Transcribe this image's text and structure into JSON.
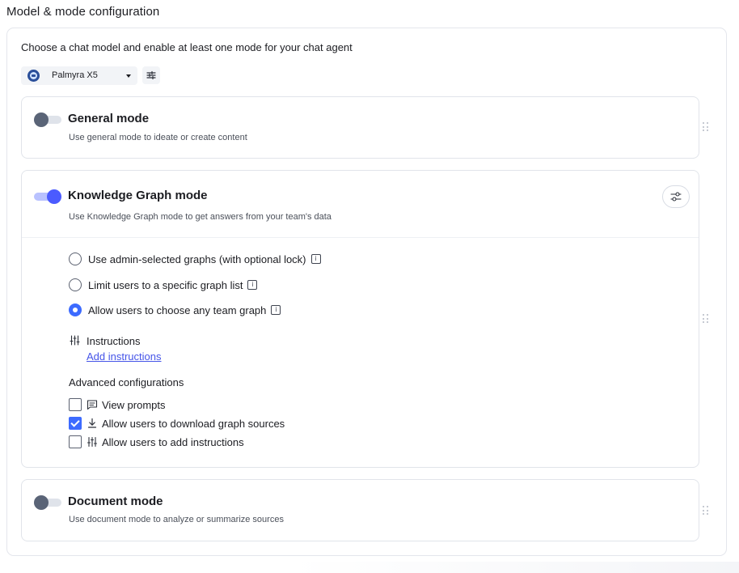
{
  "section": {
    "title": "Model & mode configuration",
    "subtitle": "Choose a chat model and enable at least one mode for your chat agent"
  },
  "model_selector": {
    "selected_model": "Palmyra X5",
    "avatar_icon": "palmyra-logo-icon",
    "caret_icon": "caret-down-icon",
    "settings_icon": "sliders-icon"
  },
  "modes": {
    "general": {
      "title": "General mode",
      "description": "Use general mode to ideate or create content",
      "enabled": false
    },
    "knowledge_graph": {
      "title": "Knowledge Graph mode",
      "description": "Use Knowledge Graph mode to get answers from your team's data",
      "enabled": true,
      "settings_icon": "sliders-icon",
      "graph_options": [
        {
          "label": "Use admin-selected graphs (with optional lock)",
          "selected": false
        },
        {
          "label": "Limit users to a specific graph list",
          "selected": false
        },
        {
          "label": "Allow users to choose any team graph",
          "selected": true
        }
      ],
      "instructions": {
        "label": "Instructions",
        "link": "Add instructions",
        "icon": "instructions-sliders-icon"
      },
      "advanced": {
        "title": "Advanced configurations",
        "options": [
          {
            "label": "View prompts",
            "checked": false,
            "icon": "chat-prompt-icon"
          },
          {
            "label": "Allow users to download graph sources",
            "checked": true,
            "icon": "download-icon"
          },
          {
            "label": "Allow users to add instructions",
            "checked": false,
            "icon": "instructions-sliders-icon"
          }
        ]
      }
    },
    "document": {
      "title": "Document mode",
      "description": "Use document mode to analyze or summarize sources",
      "enabled": false
    }
  },
  "colors": {
    "accent": "#4b5bff",
    "checkbox_accent": "#3d6bff",
    "link": "#4554e8",
    "toggle_off_knob": "#5a6477"
  }
}
